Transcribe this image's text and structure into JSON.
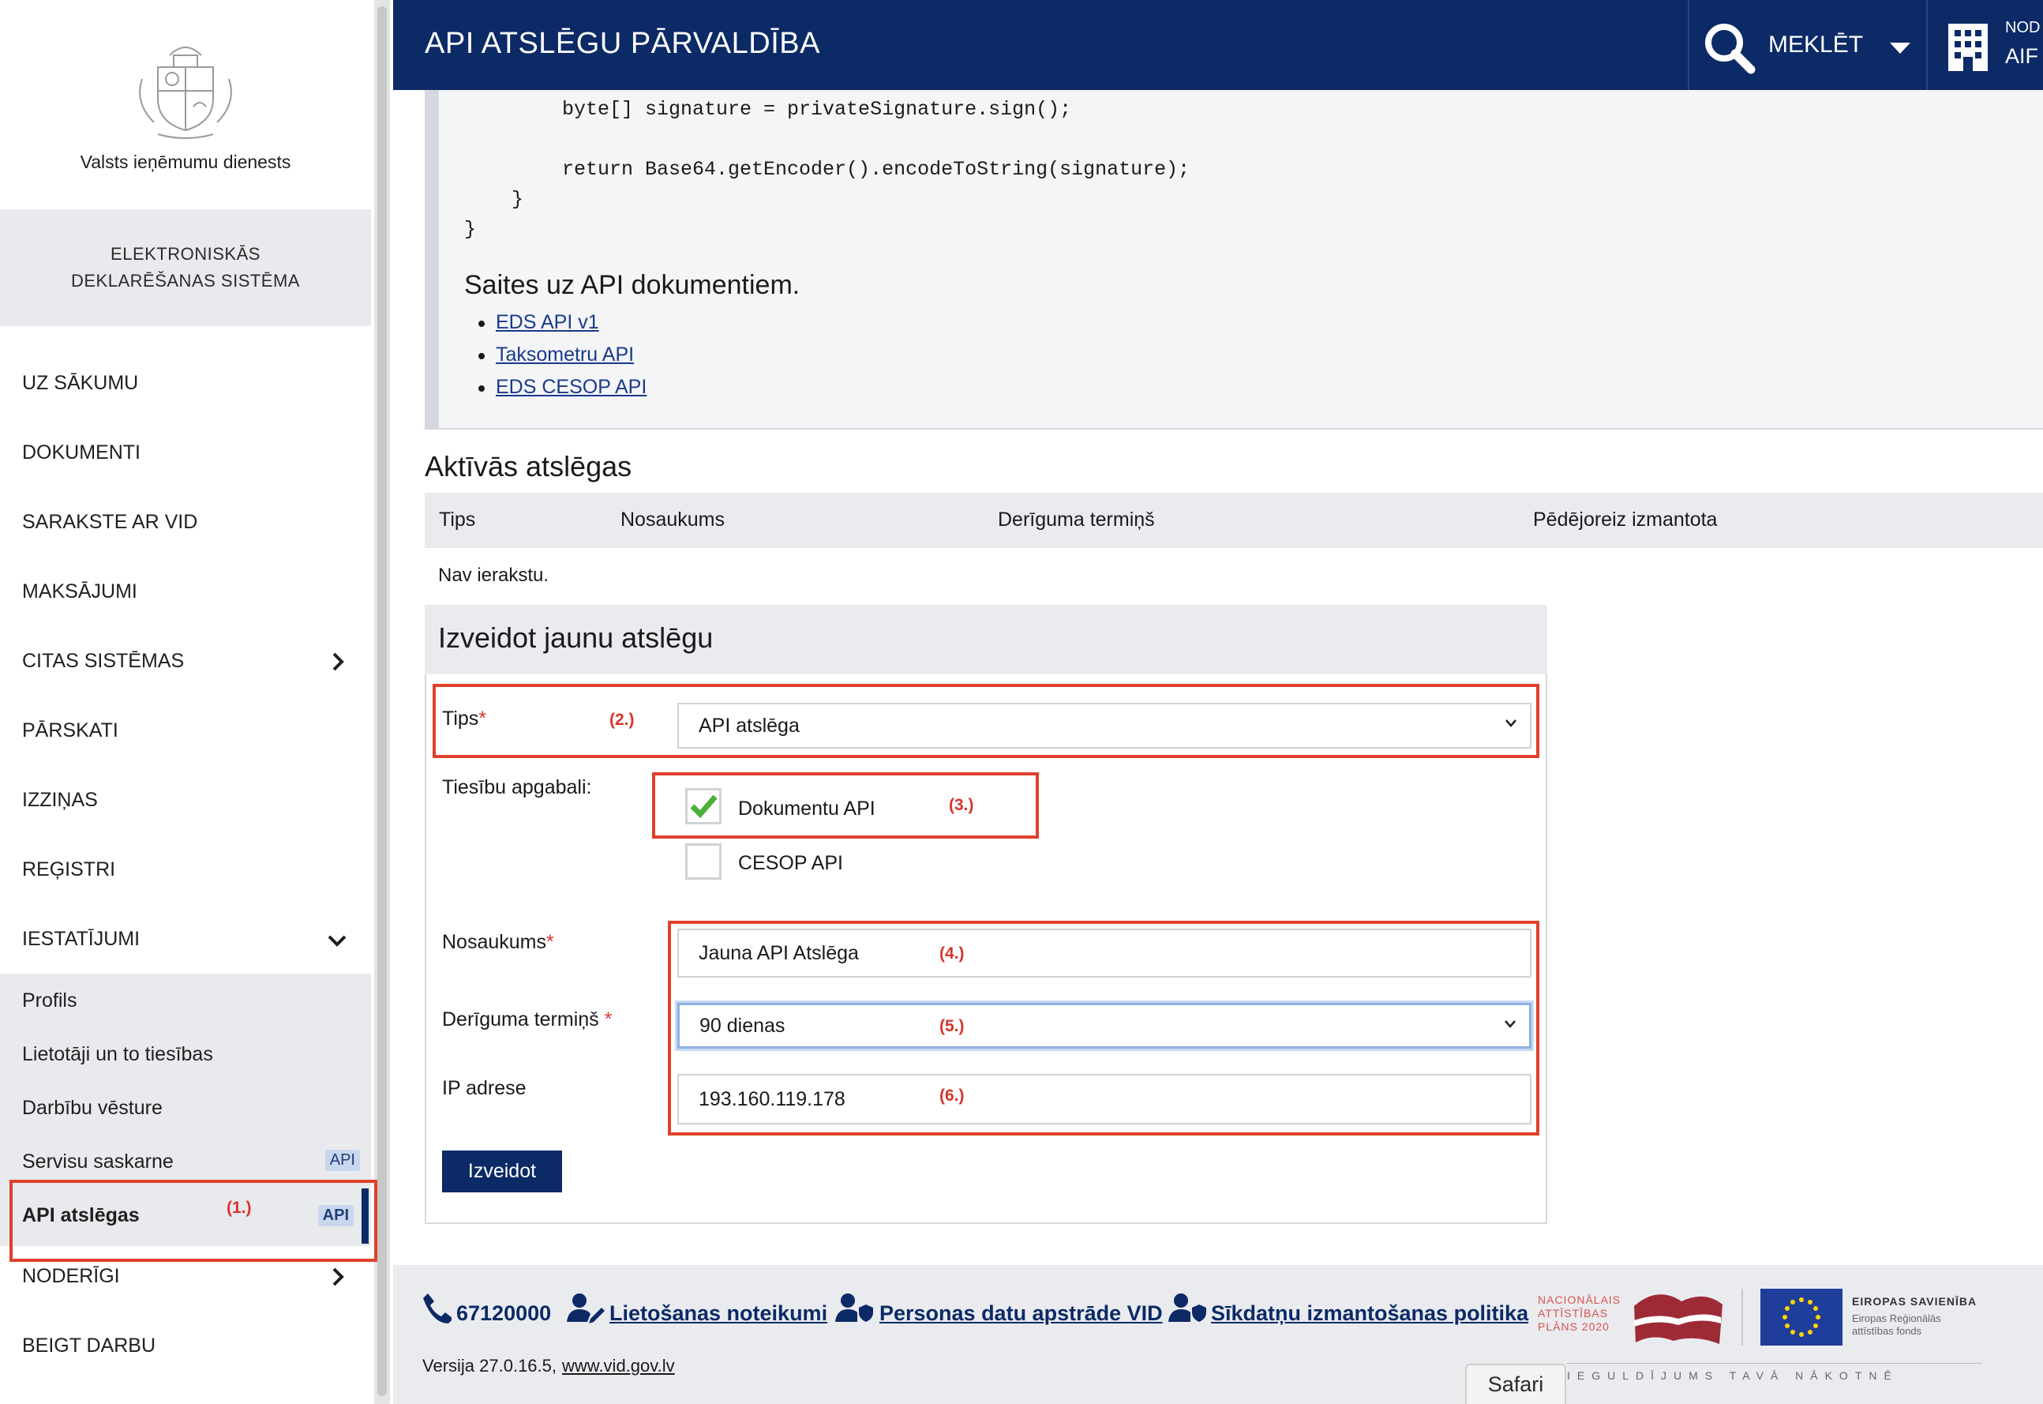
{
  "sidebar": {
    "org_name": "Valsts ieņēmumu dienests",
    "system_line1": "ELEKTRONISKĀS",
    "system_line2": "DEKLARĒŠANAS SISTĒMA",
    "nav": [
      "UZ SĀKUMU",
      "DOKUMENTI",
      "SARAKSTE AR VID",
      "MAKSĀJUMI",
      "CITAS SISTĒMAS",
      "PĀRSKATI",
      "IZZIŅAS",
      "REĢISTRI",
      "IESTATĪJUMI",
      "NODERĪGI",
      "BEIGT DARBU"
    ],
    "sub": [
      "Profils",
      "Lietotāji un to tiesības",
      "Darbību vēsture",
      "Servisu saskarne",
      "API atslēgas"
    ],
    "api_tag": "API"
  },
  "annotations": {
    "a1": "(1.)",
    "a2": "(2.)",
    "a3": "(3.)",
    "a4": "(4.)",
    "a5": "(5.)",
    "a6": "(6.)"
  },
  "header": {
    "title": "API ATSLĒGU PĀRVALDĪBA",
    "search_label": "MEKLĒT",
    "org_top": "NOD",
    "org_name": "AIF"
  },
  "code": {
    "line1": "byte[] signature = privateSignature.sign();",
    "line2": "return Base64.getEncoder().encodeToString(signature);",
    "line3": "}",
    "line4": "}"
  },
  "links": {
    "title": "Saites uz API dokumentiem.",
    "items": [
      "EDS API v1",
      "Taksometru API",
      "EDS CESOP API"
    ]
  },
  "active_keys": {
    "title": "Aktīvās atslēgas",
    "columns": [
      "Tips",
      "Nosaukums",
      "Derīguma termiņš",
      "Pēdējoreiz izmantota"
    ],
    "empty_text": "Nav ierakstu."
  },
  "form": {
    "title": "Izveidot jaunu atslēgu",
    "type_label": "Tips",
    "type_value": "API atslēga",
    "scopes_label": "Tiesību apgabali:",
    "scope1": "Dokumentu API",
    "scope2": "CESOP API",
    "name_label": "Nosaukums",
    "name_value": "Jauna API Atslēga",
    "validity_label": "Derīguma termiņš",
    "validity_value": "90 dienas",
    "ip_label": "IP adrese",
    "ip_value": "193.160.119.178",
    "required_mark": "*",
    "submit": "Izveidot"
  },
  "footer": {
    "phone": "67120000",
    "link1": "Lietošanas noteikumi",
    "link2": "Personas datu apstrāde VID",
    "link3": "Sīkdatņu izmantošanas politika",
    "version": "Versija 27.0.16.5,",
    "site": "www.vid.gov.lv",
    "nap_line1": "NACIONĀLAIS",
    "nap_line2": "ATTĪSTĪBAS",
    "nap_line3": "PLĀNS 2020",
    "eu_title": "EIROPAS SAVIENĪBA",
    "eu_sub1": "Eiropas Reģionālās",
    "eu_sub2": "attīstības fonds",
    "invest": "IEGULDĪJUMS TAVĀ NĀKOTNĒ"
  },
  "browser": {
    "safari_tab": "Safari"
  },
  "colors": {
    "brand_navy": "#0c2a66",
    "highlight_red": "#e0402b",
    "check_green": "#4caf3a"
  }
}
